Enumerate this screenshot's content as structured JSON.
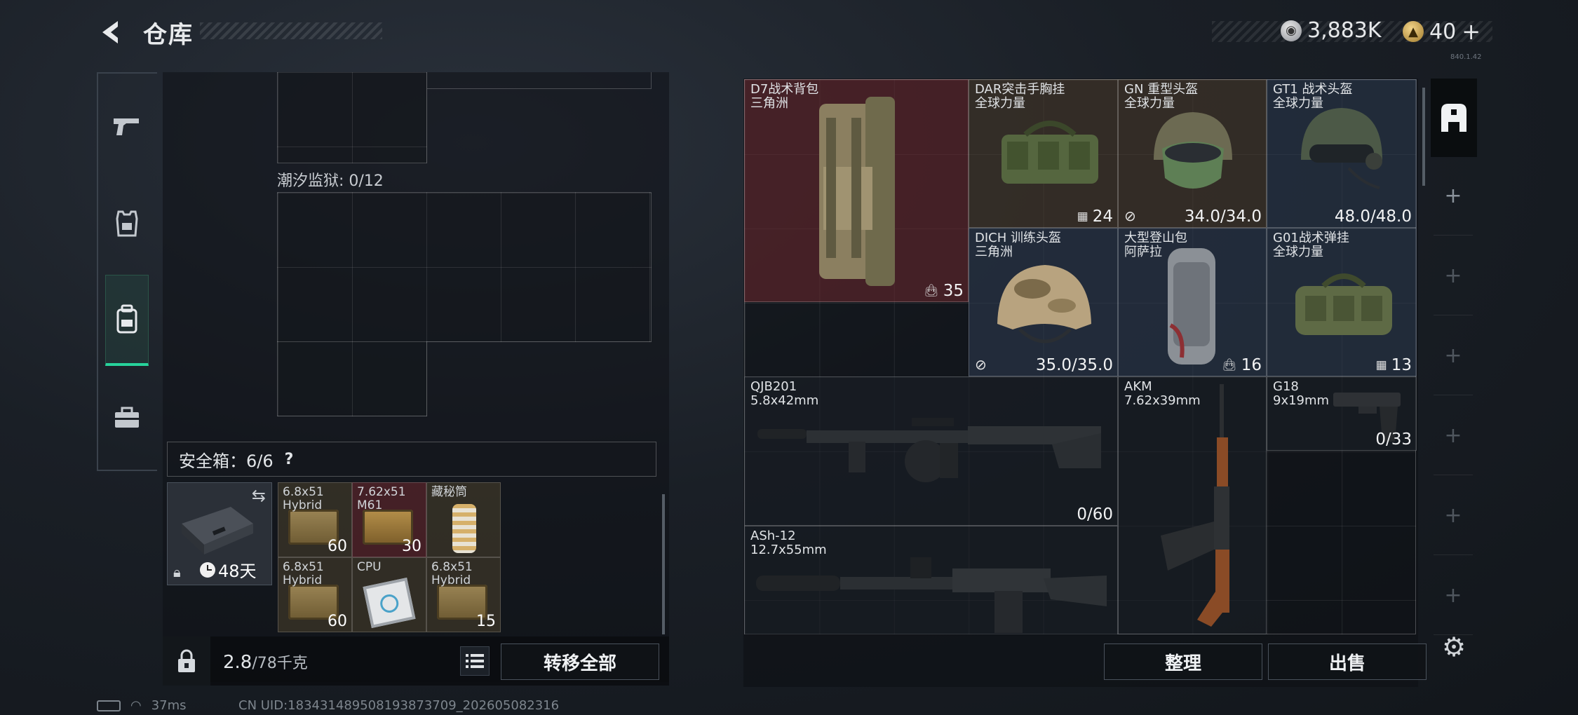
{
  "header": {
    "title": "仓库",
    "currency_silver": "3,883K",
    "currency_gold": "40",
    "currency_add": "+",
    "version": "840.1.42"
  },
  "left_tabs": [
    {
      "icon": "pistol-icon"
    },
    {
      "icon": "armor-vest-icon"
    },
    {
      "icon": "backpack-icon",
      "active": true
    },
    {
      "icon": "toolbox-icon"
    }
  ],
  "containers": {
    "prison_label": "潮汐监狱: 0/12",
    "safebox_label": "安全箱：6/6",
    "safebox_help": "?",
    "case_days": "48天"
  },
  "safebox_items": [
    {
      "name": "6.8x51\nHybrid",
      "qty": "60"
    },
    {
      "name": "7.62x51\nM61",
      "qty": "30"
    },
    {
      "name": "藏秘筒",
      "qty": ""
    },
    {
      "name": "6.8x51\nHybrid",
      "qty": "60"
    },
    {
      "name": "CPU",
      "qty": ""
    },
    {
      "name": "6.8x51\nHybrid",
      "qty": "15"
    }
  ],
  "left_footer": {
    "weight_current": "2.8",
    "weight_max": "/78千克",
    "transfer_all": "转移全部"
  },
  "stash_items": {
    "d7": {
      "title": "D7战术背包\n三角洲",
      "stat": "35"
    },
    "dar": {
      "title": "DAR突击手胸挂\n全球力量",
      "stat": "24"
    },
    "gn": {
      "title": "GN 重型头盔\n全球力量",
      "stat": "34.0/34.0"
    },
    "gt1": {
      "title": "GT1 战术头盔\n全球力量",
      "stat": "48.0/48.0"
    },
    "dich": {
      "title": "DICH 训练头盔\n三角洲",
      "stat": "35.0/35.0"
    },
    "mountain": {
      "title": "大型登山包\n阿萨拉",
      "stat": "16"
    },
    "g01": {
      "title": "G01战术弹挂\n全球力量",
      "stat": "13"
    },
    "qjb": {
      "title": "QJB201\n5.8x42mm",
      "stat": "0/60"
    },
    "akm": {
      "title": "AKM\n7.62x39mm",
      "stat": ""
    },
    "g18": {
      "title": "G18\n9x19mm",
      "stat": "0/33"
    },
    "ash": {
      "title": "ASh-12\n12.7x55mm",
      "stat": ""
    }
  },
  "stash_footer": {
    "sort": "整理",
    "sell": "出售"
  },
  "status": {
    "ping": "37ms",
    "uid": "CN UID:1834314895081938737​09_202605082316"
  },
  "colors": {
    "accent_green": "#27d39b",
    "rarity_red": "#6e282d",
    "rarity_brown": "#4e4030",
    "rarity_blue": "#303e54"
  }
}
